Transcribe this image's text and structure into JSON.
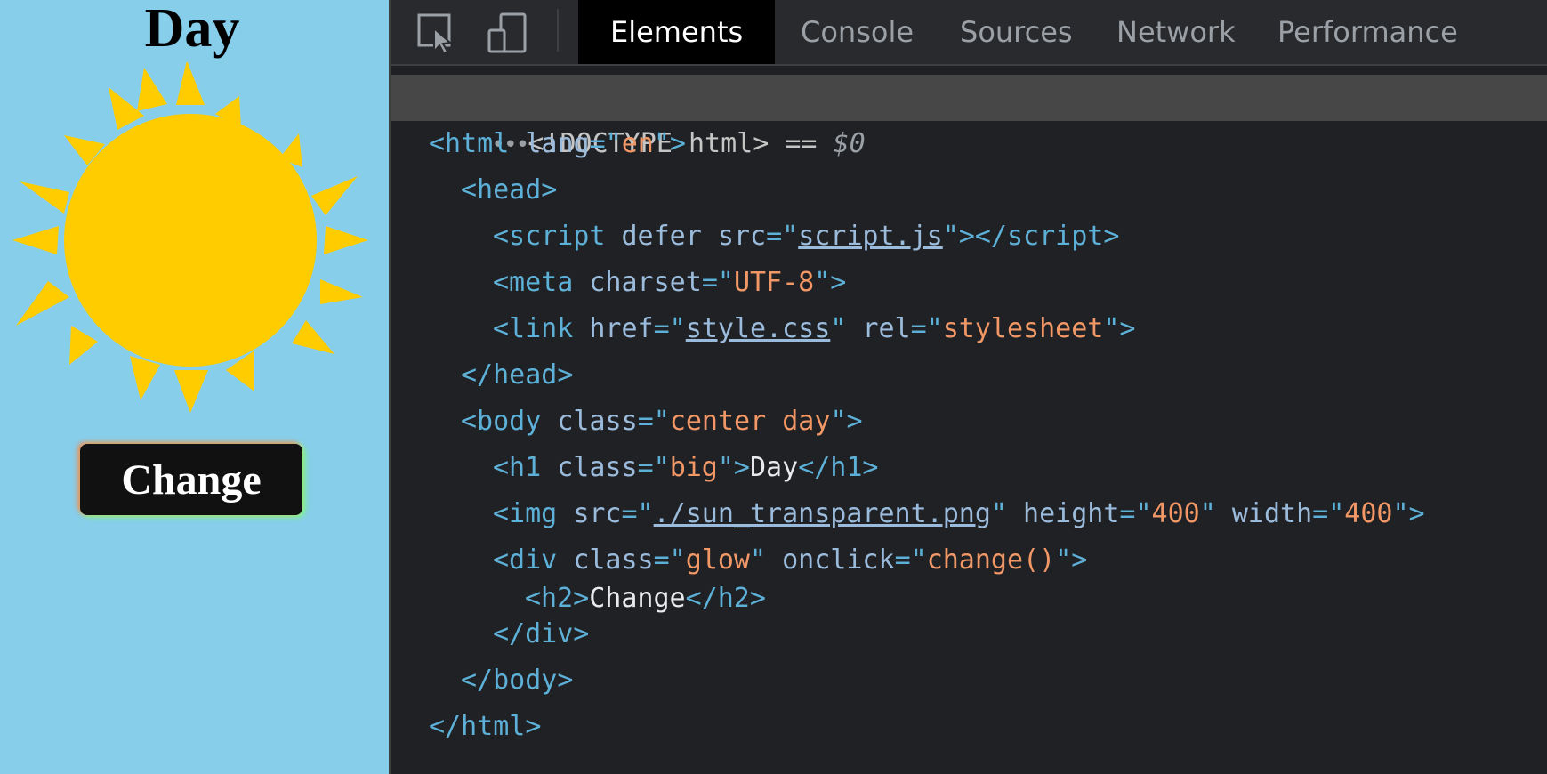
{
  "page": {
    "heading": "Day",
    "button_label": "Change",
    "colors": {
      "background": "#87ceeb",
      "sun": "#ffcc00",
      "button": "#111111"
    }
  },
  "devtools": {
    "tabs": [
      "Elements",
      "Console",
      "Sources",
      "Network",
      "Performance"
    ],
    "active_tab": "Elements",
    "icons": [
      "inspect-element-icon",
      "device-toolbar-icon"
    ],
    "dom": {
      "doctype_dots": "•••",
      "doctype": "<!DOCTYPE html>",
      "doctype_eq": " == ",
      "doctype_ref": "$0",
      "html_lang": "en",
      "script_src": "script.js",
      "meta_charset": "UTF-8",
      "link_href": "style.css",
      "link_rel": "stylesheet",
      "body_class": "center day",
      "h1_class": "big",
      "h1_text": "Day",
      "img_src": "./sun_transparent.png",
      "img_height": "400",
      "img_width": "400",
      "div_class": "glow",
      "div_onclick": "change()",
      "h2_text": "Change"
    }
  }
}
